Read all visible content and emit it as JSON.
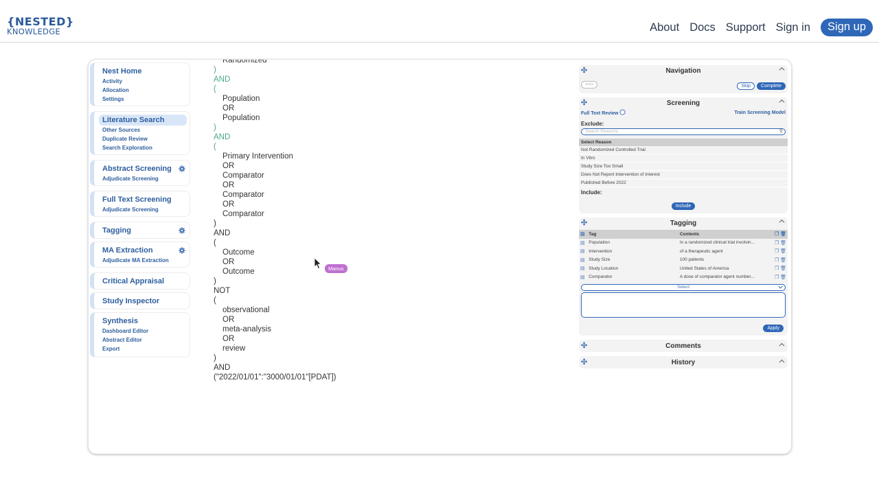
{
  "header": {
    "logo_line1": "{NESTED}",
    "logo_line2": "KNOWLEDGE",
    "nav": [
      "About",
      "Docs",
      "Support",
      "Sign in"
    ],
    "signup": "Sign up"
  },
  "sidebar": {
    "groups": [
      {
        "main": "Nest Home",
        "subs": [
          "Activity",
          "Allocation",
          "Settings"
        ]
      },
      {
        "main": "Literature Search",
        "subs": [
          "Other Sources",
          "Duplicate Review",
          "Search Exploration"
        ]
      },
      {
        "main": "Abstract Screening",
        "subs": [
          "Adjudicate Screening"
        ]
      },
      {
        "main": "Full Text Screening",
        "subs": [
          "Adjudicate Screening"
        ]
      },
      {
        "main": "Tagging",
        "subs": []
      },
      {
        "main": "MA Extraction",
        "subs": [
          "Adjudicate MA Extraction"
        ]
      },
      {
        "main": "Critical Appraisal",
        "subs": []
      },
      {
        "main": "Study Inspector",
        "subs": []
      },
      {
        "main": "Synthesis",
        "subs": [
          "Dashboard Editor",
          "Abstract Editor",
          "Export"
        ]
      }
    ]
  },
  "query": {
    "lines": [
      "Randomized",
      ")",
      "AND",
      "(",
      "Population",
      "OR",
      "Population",
      ")",
      "AND",
      "(",
      "Primary Intervention",
      "OR",
      "Comparator",
      "OR",
      "Comparator",
      "OR",
      "Comparator",
      ")",
      "AND",
      "(",
      "Outcome",
      "OR",
      "Outcome",
      ")",
      "NOT",
      "(",
      "observational",
      "OR",
      "meta-analysis",
      "OR",
      "review",
      ")",
      "AND",
      "(\"2022/01/01\":\"3000/01/01\"[PDAT])"
    ]
  },
  "cursor_label": "Manus",
  "navigation": {
    "title": "Navigation",
    "back": "<<>",
    "skip": "Skip",
    "complete": "Complete"
  },
  "screening": {
    "title": "Screening",
    "full_text_review": "Full Text Review",
    "train_model": "Train Screening Model",
    "exclude_label": "Exclude:",
    "search_placeholder": "Search Reasons",
    "select_reason": "Select Reason",
    "reasons": [
      "Not Randomized Controlled Trial",
      "In Vitro",
      "Study Size Too Small",
      "Does Not Report Intervention of Interest",
      "Published Before 2022"
    ],
    "include_label": "Include:",
    "include_button": "Include"
  },
  "tagging": {
    "title": "Tagging",
    "col_tag": "Tag",
    "col_contents": "Contents",
    "rows": [
      {
        "tag": "Population",
        "contents": "In a randomized clinical trial involvin..."
      },
      {
        "tag": "Intervention",
        "contents": "of a therapeutic agent"
      },
      {
        "tag": "Study Size",
        "contents": "100 patients"
      },
      {
        "tag": "Study Location",
        "contents": "United States of America"
      },
      {
        "tag": "Comparator",
        "contents": "A dose of comparator agent number..."
      }
    ],
    "select": "Select",
    "apply": "Apply"
  },
  "comments": {
    "title": "Comments"
  },
  "history": {
    "title": "History"
  }
}
